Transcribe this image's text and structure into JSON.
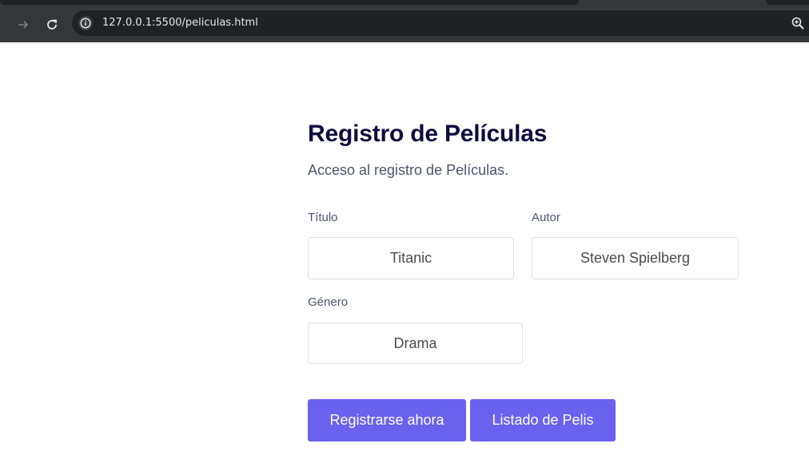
{
  "browser": {
    "url": "127.0.0.1:5500/peliculas.html",
    "icons": [
      "forward-icon",
      "reload-icon",
      "info-icon",
      "zoom-icon"
    ]
  },
  "page": {
    "title": "Registro de Películas",
    "subtitle": "Acceso al registro de Películas.",
    "fields": {
      "titulo": {
        "label": "Título",
        "value": "Titanic"
      },
      "autor": {
        "label": "Autor",
        "value": "Steven Spielberg"
      },
      "genero": {
        "label": "Género",
        "value": "Drama"
      }
    },
    "buttons": {
      "register": "Registrarse ahora",
      "list": "Listado de Pelis"
    },
    "colors": {
      "accent": "#6b61ef",
      "title": "#0f0d3d"
    }
  }
}
